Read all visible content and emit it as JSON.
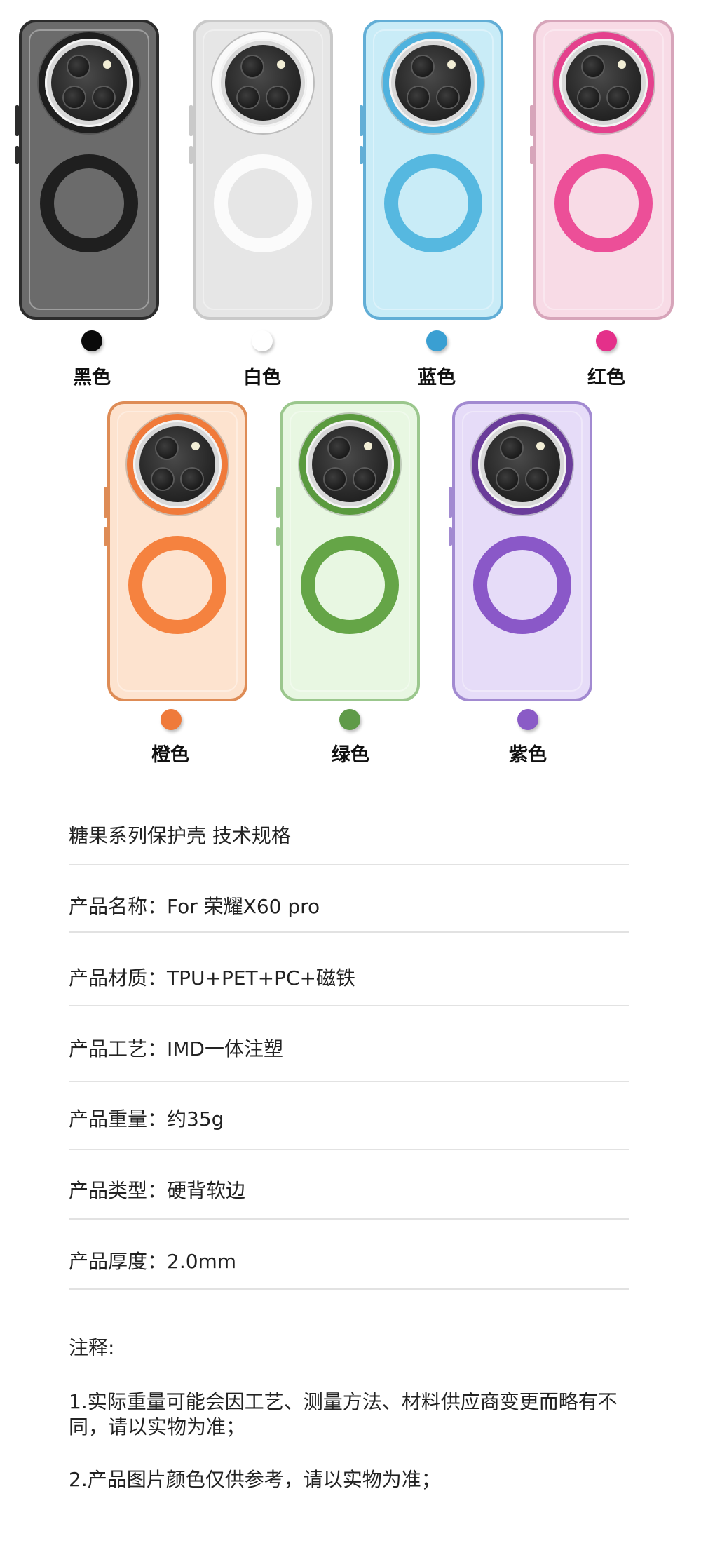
{
  "variants": [
    {
      "label": "黑色",
      "edge": "#2c2c2c",
      "body": "#6b6b6b",
      "ring": "#1e1e1e",
      "mag": "#1f1f1f",
      "dot": "#0a0a0a"
    },
    {
      "label": "白色",
      "edge": "#c9c9c9",
      "body": "#e6e6e6",
      "ring": "#fafafa",
      "mag": "#fbfbfb",
      "dot": "#ffffff"
    },
    {
      "label": "蓝色",
      "edge": "#62aed6",
      "body": "#c9ecf7",
      "ring": "#4fb2de",
      "mag": "#56b8e0",
      "dot": "#3a9fd2"
    },
    {
      "label": "红色",
      "edge": "#d7a5ba",
      "body": "#f8dbe6",
      "ring": "#e4418d",
      "mag": "#ec4f98",
      "dot": "#e4308a"
    },
    {
      "label": "橙色",
      "edge": "#de8c56",
      "body": "#fde3cf",
      "ring": "#f07a3a",
      "mag": "#f5823f",
      "dot": "#ef7a3b"
    },
    {
      "label": "绿色",
      "edge": "#9bc78d",
      "body": "#e8f7e2",
      "ring": "#5a9a3e",
      "mag": "#65a547",
      "dot": "#5f9a48"
    },
    {
      "label": "紫色",
      "edge": "#a28ad1",
      "body": "#e6dcf8",
      "ring": "#6a3c9a",
      "mag": "#8a58c8",
      "dot": "#8a5bc6"
    }
  ],
  "spec": {
    "title": "糖果系列保护壳 技术规格",
    "rows": [
      "产品名称：For 荣耀X60 pro",
      "产品材质：TPU+PET+PC+磁铁",
      "产品工艺：IMD一体注塑",
      "产品重量：约35g",
      "产品类型：硬背软边",
      "产品厚度：2.0mm"
    ]
  },
  "notes": {
    "heading": "注释:",
    "items": [
      "1.实际重量可能会因工艺、测量方法、材料供应商变更而略有不同，请以实物为准；",
      "2.产品图片颜色仅供参考，请以实物为准；"
    ]
  }
}
